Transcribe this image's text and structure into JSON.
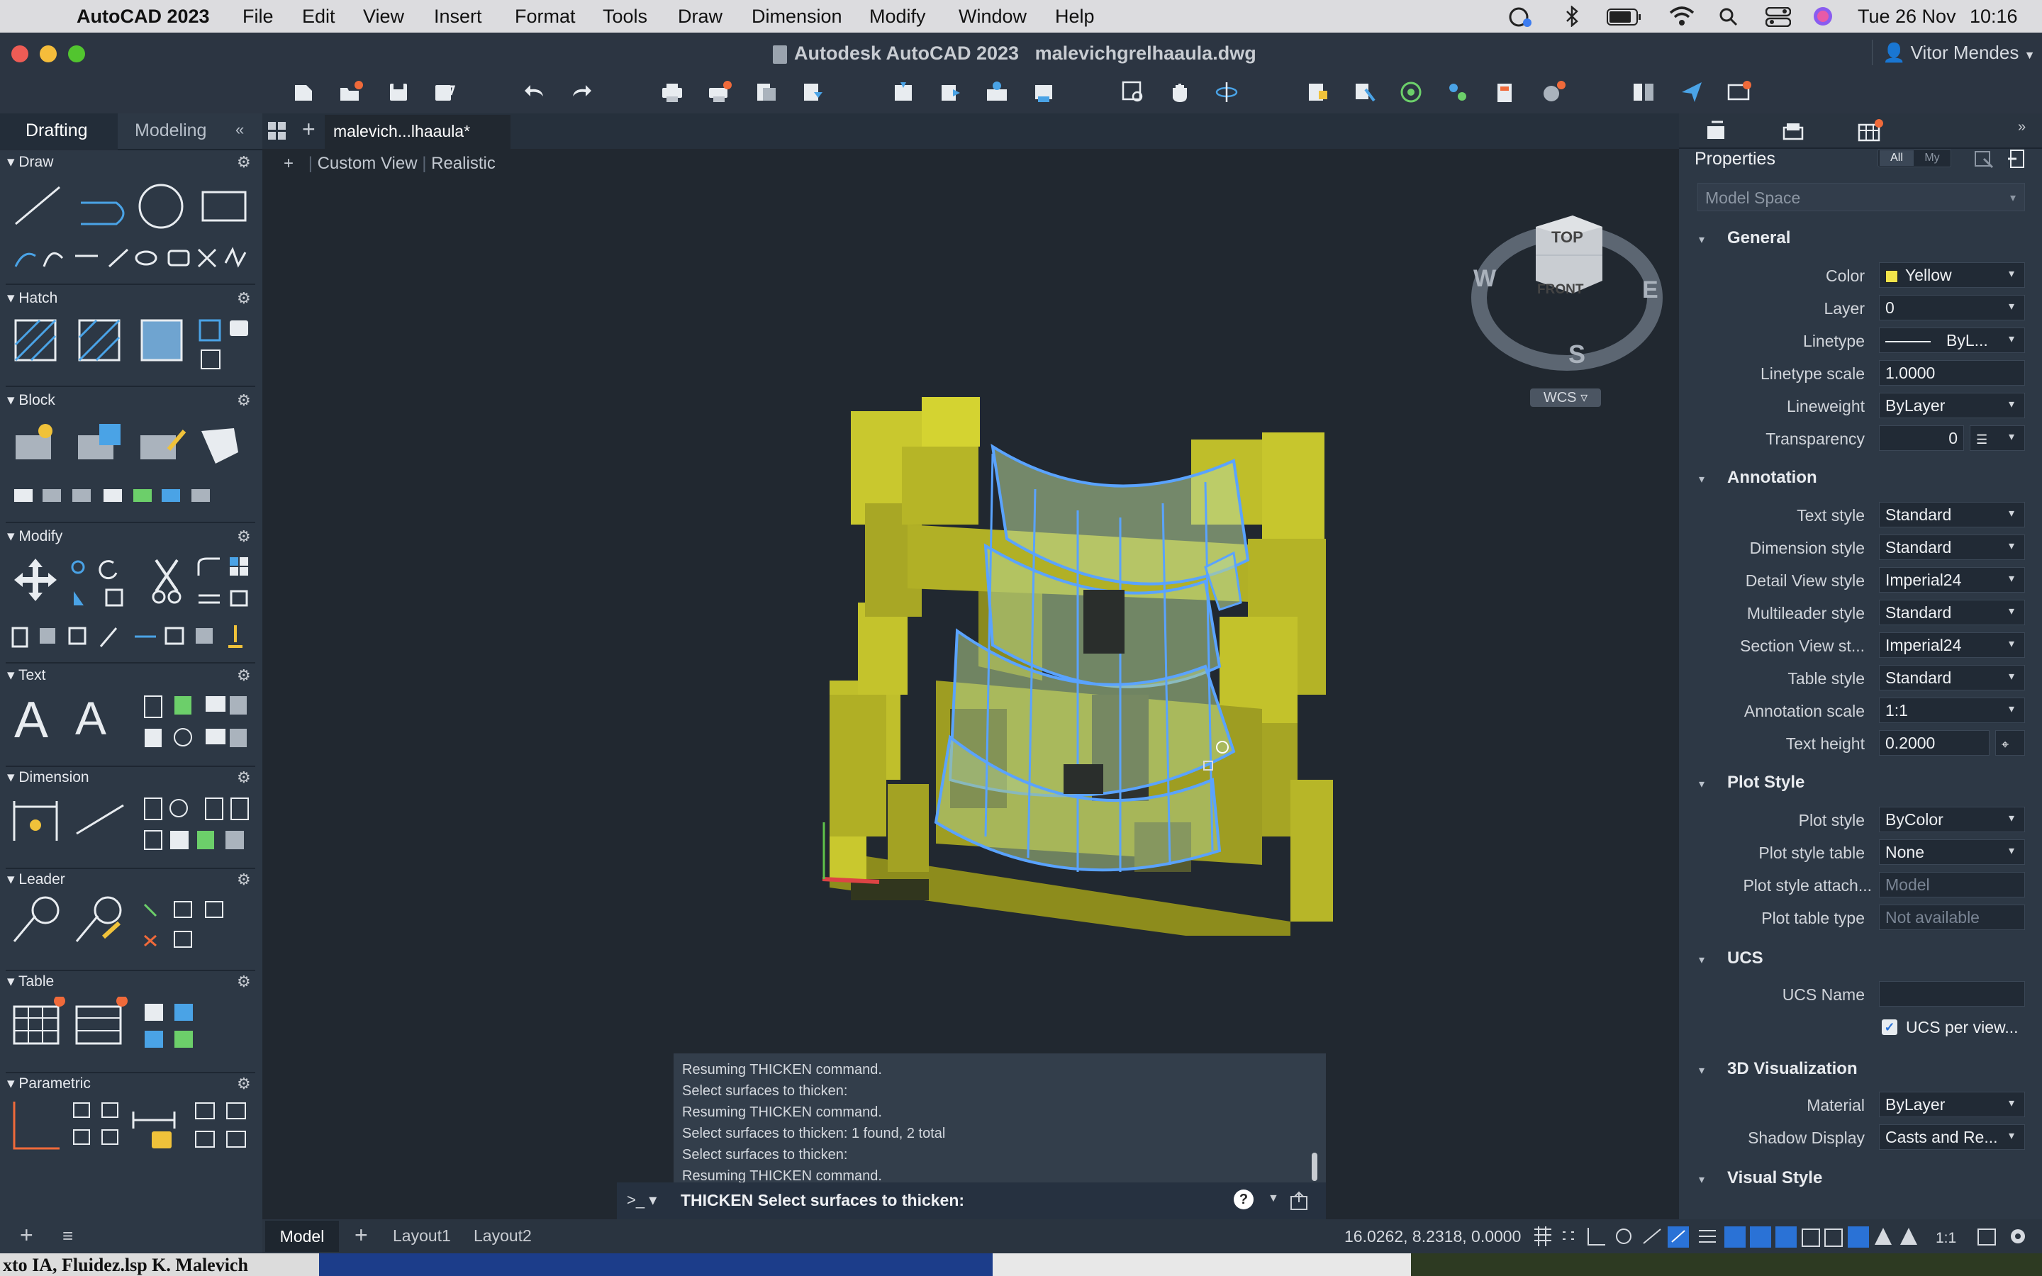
{
  "menubar": {
    "app": "AutoCAD 2023",
    "items": [
      "File",
      "Edit",
      "View",
      "Insert",
      "Format",
      "Tools",
      "Draw",
      "Dimension",
      "Modify",
      "Window",
      "Help"
    ],
    "date": "Tue 26 Nov",
    "time": "10:16"
  },
  "window": {
    "title_app": "Autodesk AutoCAD 2023",
    "title_file": "malevichgrelhaaula.dwg",
    "user": "Vitor Mendes"
  },
  "palette": {
    "tabs": [
      "Drafting",
      "Modeling"
    ],
    "sections": [
      "Draw",
      "Hatch",
      "Block",
      "Modify",
      "Text",
      "Dimension",
      "Leader",
      "Table",
      "Parametric"
    ]
  },
  "viewport": {
    "doc_tab": "malevich...lhaaula*",
    "view_plus": "+",
    "view_name": "Custom View",
    "visual_style": "Realistic",
    "viewcube": {
      "top": "TOP",
      "front": "FRONT",
      "w": "W",
      "e": "E",
      "s": "S",
      "wcs": "WCS"
    }
  },
  "properties": {
    "title": "Properties",
    "filter_all": "All",
    "filter_my": "My",
    "space": "Model Space",
    "groups": [
      {
        "name": "General",
        "rows": [
          {
            "label": "Color",
            "value": "Yellow",
            "swatch": "#f3e44a"
          },
          {
            "label": "Layer",
            "value": "0"
          },
          {
            "label": "Linetype",
            "value": "ByL..."
          },
          {
            "label": "Linetype scale",
            "value": "1.0000"
          },
          {
            "label": "Lineweight",
            "value": "ByLayer"
          },
          {
            "label": "Transparency",
            "value": "0"
          }
        ]
      },
      {
        "name": "Annotation",
        "rows": [
          {
            "label": "Text style",
            "value": "Standard"
          },
          {
            "label": "Dimension style",
            "value": "Standard"
          },
          {
            "label": "Detail View style",
            "value": "Imperial24"
          },
          {
            "label": "Multileader style",
            "value": "Standard"
          },
          {
            "label": "Section View st...",
            "value": "Imperial24"
          },
          {
            "label": "Table style",
            "value": "Standard"
          },
          {
            "label": "Annotation scale",
            "value": "1:1"
          },
          {
            "label": "Text height",
            "value": "0.2000"
          }
        ]
      },
      {
        "name": "Plot Style",
        "rows": [
          {
            "label": "Plot style",
            "value": "ByColor"
          },
          {
            "label": "Plot style table",
            "value": "None"
          },
          {
            "label": "Plot style attach...",
            "value": "Model"
          },
          {
            "label": "Plot table type",
            "value": "Not available"
          }
        ]
      },
      {
        "name": "UCS",
        "rows": [
          {
            "label": "UCS Name",
            "value": ""
          },
          {
            "label": "",
            "value": "UCS per view..."
          }
        ]
      },
      {
        "name": "3D Visualization",
        "rows": [
          {
            "label": "Material",
            "value": "ByLayer"
          },
          {
            "label": "Shadow Display",
            "value": "Casts and Re..."
          }
        ]
      },
      {
        "name": "Visual Style",
        "rows": []
      }
    ]
  },
  "command": {
    "log": [
      "Resuming THICKEN command.",
      "Select surfaces to thicken:",
      "Resuming THICKEN command.",
      "Select surfaces to thicken: 1 found, 2 total",
      "Select surfaces to thicken:",
      "Resuming THICKEN command."
    ],
    "prompt": "THICKEN Select surfaces to thicken:",
    "prompt_symbol": ">_"
  },
  "status": {
    "tabs": [
      "Model",
      "Layout1",
      "Layout2"
    ],
    "coords": "16.0262, 8.2318, 0.0000",
    "scale": "1:1"
  },
  "footer": {
    "text": "xto IA, Fluidez.lsp K. Malevich"
  }
}
